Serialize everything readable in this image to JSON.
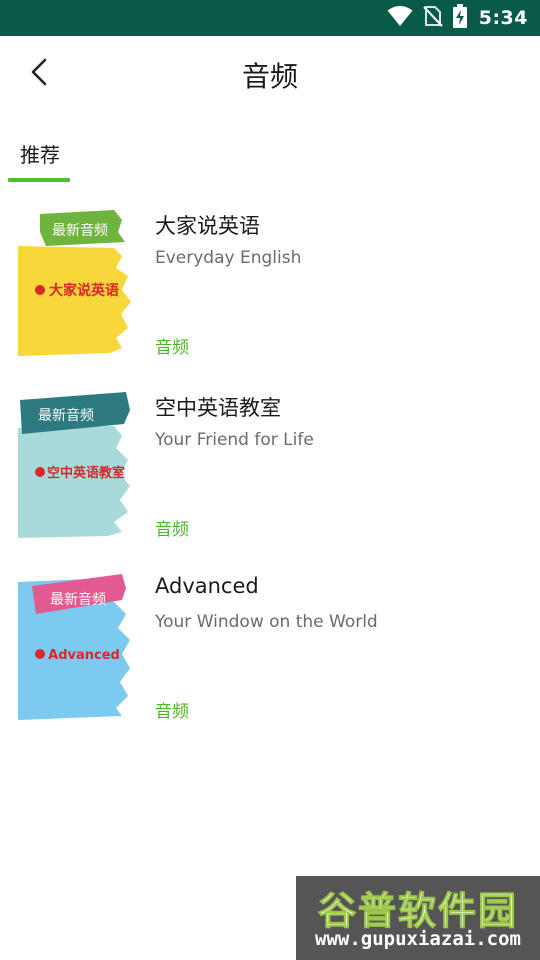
{
  "status_bar": {
    "time": "5:34",
    "icons": [
      "wifi-icon",
      "no-sim-icon",
      "battery-charging-icon"
    ]
  },
  "header": {
    "title": "音频",
    "back_icon": "chevron-left-icon"
  },
  "tabs": [
    {
      "label": "推荐",
      "active": true
    }
  ],
  "items": [
    {
      "title": "大家说英语",
      "subtitle": "Everyday English",
      "tag": "音频",
      "cover": {
        "banner": "最新音频",
        "logo_text": "大家说英语",
        "banner_color": "#6fb43f",
        "bg_color": "#f7d73a"
      }
    },
    {
      "title": "空中英语教室",
      "subtitle": "Your Friend for Life",
      "tag": "音频",
      "cover": {
        "banner": "最新音频",
        "logo_text": "空中英语教室",
        "banner_color": "#2d7a80",
        "bg_color": "#a7dad8"
      }
    },
    {
      "title": "Advanced",
      "subtitle": "Your Window on the World",
      "tag": "音频",
      "cover": {
        "banner": "最新音频",
        "logo_text": "Advanced",
        "banner_color": "#e25a8f",
        "bg_color": "#7ccaed"
      }
    }
  ],
  "watermark": {
    "text": "谷普软件园",
    "url": "www.gupuxiazai.com"
  },
  "colors": {
    "status_bar": "#0a5a49",
    "accent_green": "#4cc02c",
    "logo_red": "#d9262a"
  }
}
